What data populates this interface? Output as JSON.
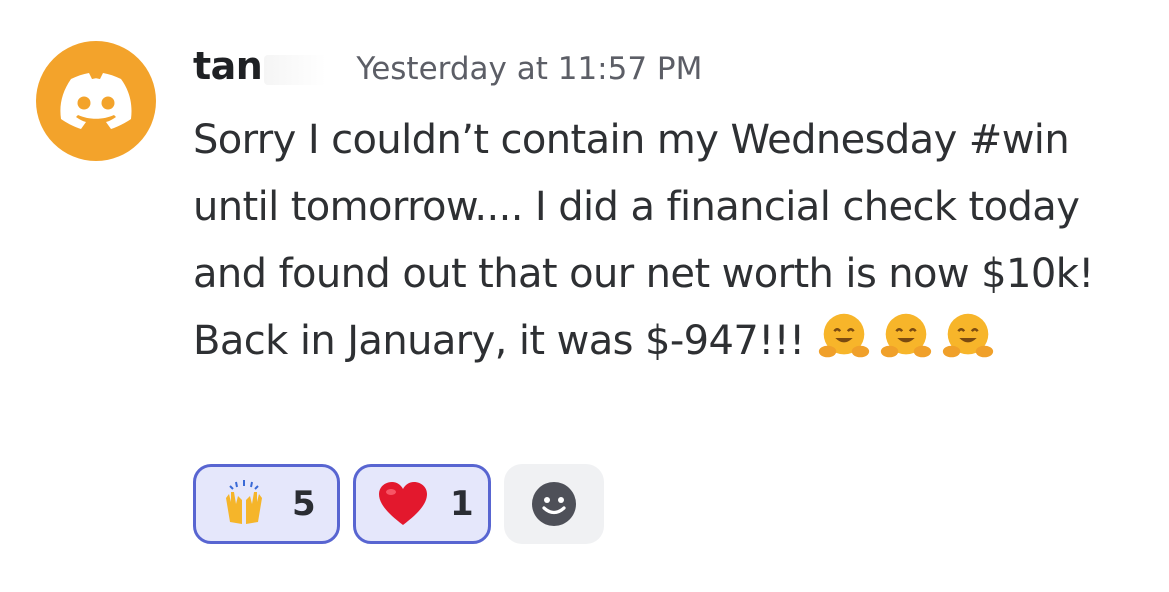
{
  "message": {
    "author": {
      "username": "tan",
      "avatar_icon": "discord-logo-icon",
      "avatar_color": "#f3a32b"
    },
    "timestamp": "Yesterday at 11:57 PM",
    "content": "Sorry I couldn’t contain my Wednesday #win until tomorrow.... I did a financial check today and found out that our net worth is now $10k! Back in January, it was $-947!!!",
    "emojis": [
      "hugging-face-icon",
      "hugging-face-icon",
      "hugging-face-icon"
    ]
  },
  "reactions": [
    {
      "icon": "raising-hands-icon",
      "count": "5",
      "selected": true
    },
    {
      "icon": "red-heart-icon",
      "count": "1",
      "selected": true
    }
  ],
  "add_reaction": {
    "icon": "smile-add-reaction-icon"
  },
  "colors": {
    "accent": "#5865d1",
    "reaction_bg": "#e5e7fb",
    "add_bg": "#f0f1f3"
  }
}
